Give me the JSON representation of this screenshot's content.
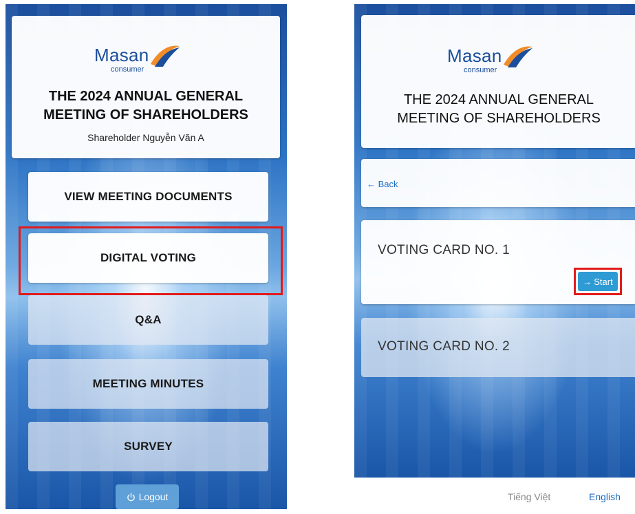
{
  "colors": {
    "accent_blue": "#2f9bd4",
    "highlight_red": "#e21b1b",
    "brand_blue": "#1b4e9b",
    "logo_orange": "#f28c28"
  },
  "brand": {
    "name": "Masan",
    "sub": "consumer"
  },
  "left_screen": {
    "title_line1": "THE 2024 ANNUAL GENERAL",
    "title_line2": "MEETING OF SHAREHOLDERS",
    "shareholder": "Shareholder Nguyễn Văn A",
    "menu": [
      {
        "label": "VIEW MEETING DOCUMENTS"
      },
      {
        "label": "DIGITAL VOTING"
      },
      {
        "label": "Q&A"
      },
      {
        "label": "MEETING MINUTES"
      },
      {
        "label": "SURVEY"
      }
    ],
    "logout_icon": "power-icon",
    "logout_label": "Logout"
  },
  "right_screen": {
    "title_line1": "THE 2024 ANNUAL GENERAL",
    "title_line2": "MEETING OF SHAREHOLDERS",
    "back_icon": "arrow-left-icon",
    "back_label": "Back",
    "voting_cards": [
      {
        "title": "VOTING CARD NO. 1",
        "button": "Start",
        "button_icon": "arrow-right-icon"
      },
      {
        "title": "VOTING CARD NO. 2"
      }
    ]
  },
  "language": {
    "vietnamese": "Tiếng Việt",
    "english": "English"
  }
}
